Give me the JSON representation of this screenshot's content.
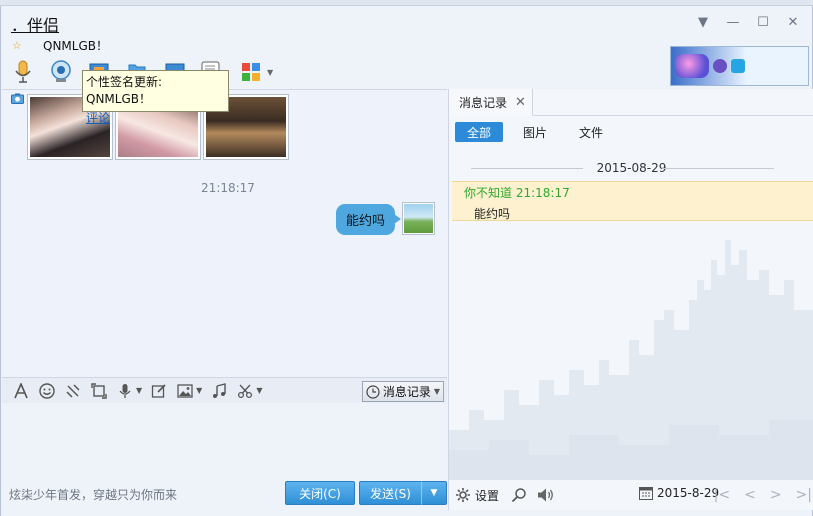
{
  "window": {
    "title": "．伴侣",
    "signature": "QNMLGB！",
    "controls": {
      "menu": "▼",
      "minimize": "—",
      "maximize": "☐",
      "close": "✕"
    }
  },
  "toolbar": {
    "icons": [
      "microphone-icon",
      "webcam-icon",
      "remote-assist-icon",
      "file-transfer-icon",
      "screen-share-icon",
      "create-discussion-icon",
      "apps-icon"
    ]
  },
  "tooltip": {
    "text": "个性签名更新:  QNMLGB！",
    "link": "评论"
  },
  "chat": {
    "timestamp": "21:18:17",
    "message": "能约吗"
  },
  "input_toolbar": {
    "icons": [
      "font-icon",
      "emoji-icon",
      "shake-icon",
      "screenshot-icon",
      "voice-icon",
      "edit-icon",
      "image-icon",
      "music-icon",
      "scissors-icon"
    ],
    "history_label": "消息记录"
  },
  "bottom": {
    "motto": "炫柒少年首发，穿越只为你而来",
    "close_label": "关闭(C)",
    "send_label": "发送(S)"
  },
  "history": {
    "tab_label": "消息记录",
    "filters": [
      "全部",
      "图片",
      "文件"
    ],
    "active_filter": "全部",
    "date": "2015-08-29",
    "record": {
      "sender": "你不知道",
      "time": "21:18:17",
      "text": "能约吗"
    },
    "settings_label": "设置",
    "footer_date": "2015-8-29"
  },
  "colors": {
    "accent": "#2d8ad9",
    "bubble": "#4fa7e0",
    "sender_green": "#2ea92e",
    "record_bg": "#fdf1cf"
  }
}
